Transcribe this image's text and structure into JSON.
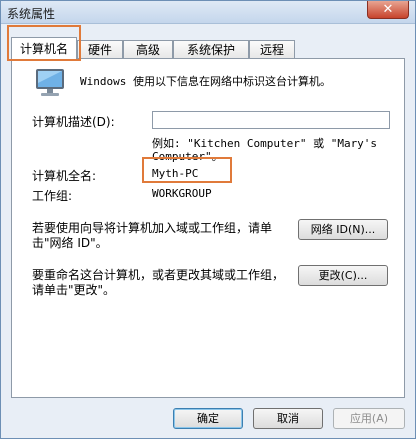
{
  "window": {
    "title": "系统属性",
    "close_label": "✕"
  },
  "tabs": [
    {
      "label": "计算机名",
      "active": true
    },
    {
      "label": "硬件",
      "active": false
    },
    {
      "label": "高级",
      "active": false
    },
    {
      "label": "系统保护",
      "active": false
    },
    {
      "label": "远程",
      "active": false
    }
  ],
  "intro_text": "Windows 使用以下信息在网络中标识这台计算机。",
  "description": {
    "label": "计算机描述(D):",
    "value": "",
    "example_line1": "例如: \"Kitchen Computer\" 或 \"Mary's",
    "example_line2": "Computer\"。"
  },
  "full_name": {
    "label": "计算机全名:",
    "value": "Myth-PC"
  },
  "workgroup": {
    "label": "工作组:",
    "value": "WORKGROUP"
  },
  "network_id": {
    "text_line1": "若要使用向导将计算机加入域或工作组，请单",
    "text_line2": "击\"网络 ID\"。",
    "button_label": "网络 ID(N)..."
  },
  "rename": {
    "text_line1": "要重命名这台计算机，或者更改其域或工作组，",
    "text_line2": "请单击\"更改\"。",
    "button_label": "更改(C)..."
  },
  "footer": {
    "ok_label": "确定",
    "cancel_label": "取消",
    "apply_label": "应用(A)"
  },
  "colors": {
    "highlight": "#e07a3a",
    "window_border": "#6d8fb5"
  }
}
